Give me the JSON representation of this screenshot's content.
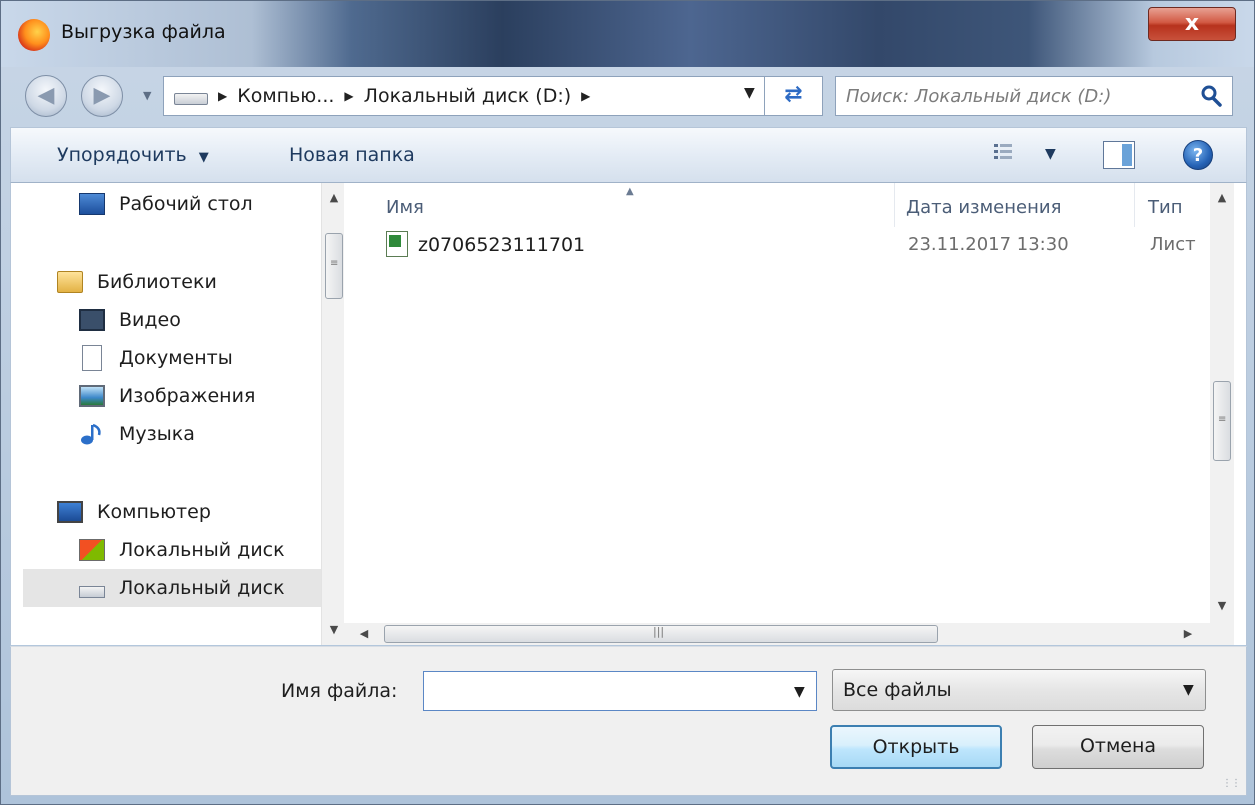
{
  "window": {
    "title": "Выгрузка файла",
    "close_label": "x"
  },
  "address": {
    "crumbs": [
      "Компью...",
      "Локальный диск (D:)"
    ],
    "search_placeholder": "Поиск: Локальный диск (D:)"
  },
  "toolbar": {
    "organize_label": "Упорядочить",
    "new_folder_label": "Новая папка"
  },
  "nav": {
    "items": [
      {
        "label": "Рабочий стол",
        "icon": "desktop-icon"
      },
      {
        "label": "Библиотеки",
        "icon": "libraries-icon"
      },
      {
        "label": "Видео",
        "icon": "video-icon"
      },
      {
        "label": "Документы",
        "icon": "documents-icon"
      },
      {
        "label": "Изображения",
        "icon": "pictures-icon"
      },
      {
        "label": "Музыка",
        "icon": "music-icon"
      },
      {
        "label": "Компьютер",
        "icon": "computer-icon"
      },
      {
        "label": "Локальный диск",
        "icon": "system-drive-icon"
      },
      {
        "label": "Локальный диск",
        "icon": "drive-icon"
      }
    ]
  },
  "files": {
    "columns": {
      "name": "Имя",
      "date": "Дата изменения",
      "type": "Тип"
    },
    "rows": [
      {
        "name": "z0706523111701",
        "date": "23.11.2017 13:30",
        "type": "Лист",
        "icon": "excel-file-icon"
      }
    ]
  },
  "bottom": {
    "filename_label": "Имя файла:",
    "filename_value": "",
    "filetype_value": "Все файлы",
    "open_label": "Открыть",
    "cancel_label": "Отмена"
  },
  "colors": {
    "accent": "#3c7fb1",
    "close_red": "#c8513b"
  }
}
